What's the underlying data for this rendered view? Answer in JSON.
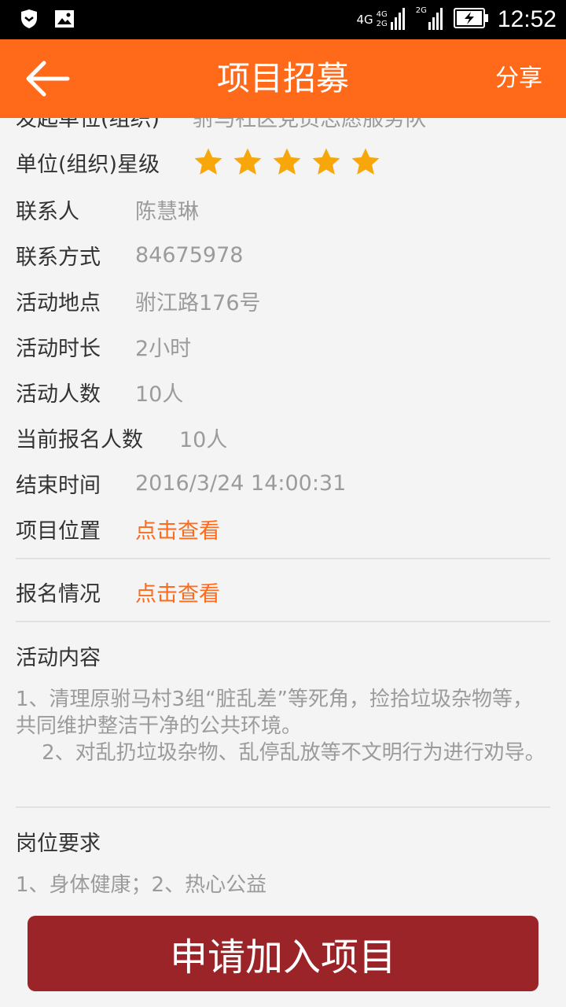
{
  "status_bar": {
    "time": "12:52",
    "net1_top": "4G",
    "net1_bottom": "2G",
    "net1_type": "4G",
    "net2_type": "2G",
    "icons": [
      "shield-icon",
      "image-icon",
      "signal-icon",
      "battery-charging-icon"
    ]
  },
  "header": {
    "title": "项目招募",
    "share_label": "分享",
    "back_icon": "arrow-left-icon",
    "bg_color": "#ff6a1a"
  },
  "details": {
    "partial_label": "发起单位(组织)",
    "partial_value": "驸马社区党员志愿服务队",
    "rating_label": "单位(组织)星级",
    "rating_stars": 5,
    "star_color": "#f7a70a",
    "contact_label": "联系人",
    "contact_value": "陈慧琳",
    "phone_label": "联系方式",
    "phone_value": "84675978",
    "location_label": "活动地点",
    "location_value": "驸江路176号",
    "duration_label": "活动时长",
    "duration_value": "2小时",
    "people_label": "活动人数",
    "people_value": "10人",
    "signed_label": "当前报名人数",
    "signed_value": "10人",
    "end_label": "结束时间",
    "end_value": "2016/3/24 14:00:31",
    "position_label": "项目位置",
    "position_link": "点击查看",
    "signup_label": "报名情况",
    "signup_link": "点击查看"
  },
  "content_section": {
    "title": "活动内容",
    "text": "1、清理原驸马村3组“脏乱差”等死角，捡拾垃圾杂物等，共同维护整洁干净的公共环境。\n    2、对乱扔垃圾杂物、乱停乱放等不文明行为进行劝导。"
  },
  "requirement_section": {
    "title": "岗位要求",
    "text": "1、身体健康；2、热心公益"
  },
  "apply_button": {
    "label": "申请加入项目",
    "color": "#9b2428"
  }
}
